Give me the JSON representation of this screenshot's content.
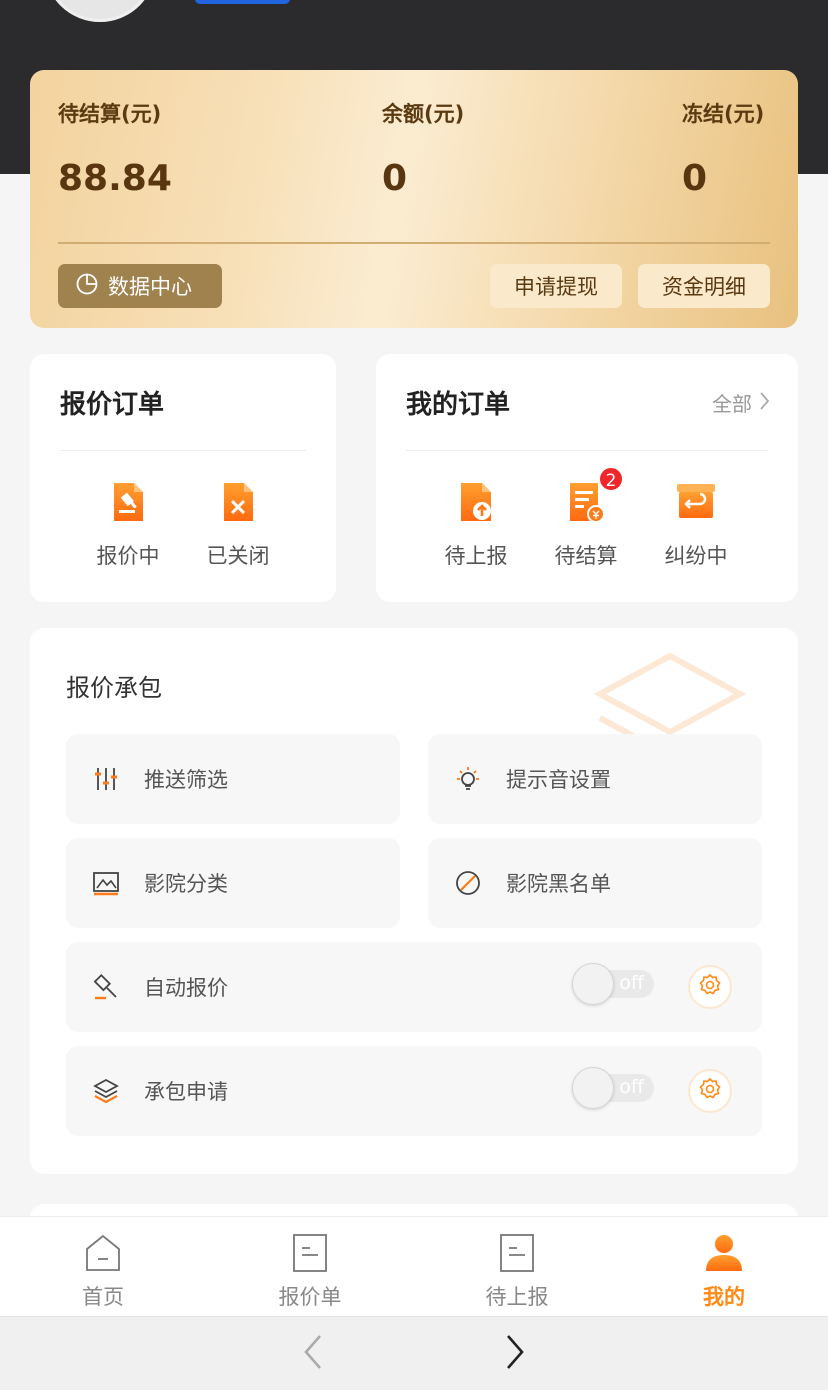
{
  "wallet": {
    "pending_label": "待结算(元)",
    "pending_value": "88.84",
    "balance_label": "余额(元)",
    "balance_value": "0",
    "frozen_label": "冻结(元)",
    "frozen_value": "0",
    "data_center_label": "数据中心",
    "withdraw_label": "申请提现",
    "funds_detail_label": "资金明细"
  },
  "quote_orders": {
    "title": "报价订单",
    "items": [
      {
        "label": "报价中",
        "icon": "gavel-doc-icon"
      },
      {
        "label": "已关闭",
        "icon": "closed-doc-icon"
      }
    ]
  },
  "my_orders": {
    "title": "我的订单",
    "all_label": "全部",
    "items": [
      {
        "label": "待上报",
        "icon": "upload-doc-icon"
      },
      {
        "label": "待结算",
        "icon": "settle-doc-icon",
        "badge": "2"
      },
      {
        "label": "纠纷中",
        "icon": "return-box-icon"
      }
    ]
  },
  "contract": {
    "title": "报价承包",
    "tiles": [
      {
        "label": "推送筛选",
        "icon": "sliders-icon"
      },
      {
        "label": "提示音设置",
        "icon": "bulb-icon"
      },
      {
        "label": "影院分类",
        "icon": "screen-icon"
      },
      {
        "label": "影院黑名单",
        "icon": "ban-icon"
      }
    ],
    "toggles": [
      {
        "label": "自动报价",
        "icon": "gavel-icon",
        "state": "off"
      },
      {
        "label": "承包申请",
        "icon": "layers-icon",
        "state": "off"
      }
    ]
  },
  "tabbar": {
    "items": [
      {
        "label": "首页",
        "icon": "home-icon"
      },
      {
        "label": "报价单",
        "icon": "quote-list-icon"
      },
      {
        "label": "待上报",
        "icon": "pending-report-icon"
      },
      {
        "label": "我的",
        "icon": "user-icon",
        "active": true
      }
    ]
  },
  "colors": {
    "accent": "#ff8a14",
    "dark_header": "#2b2b2d",
    "badge": "#f0262a"
  }
}
